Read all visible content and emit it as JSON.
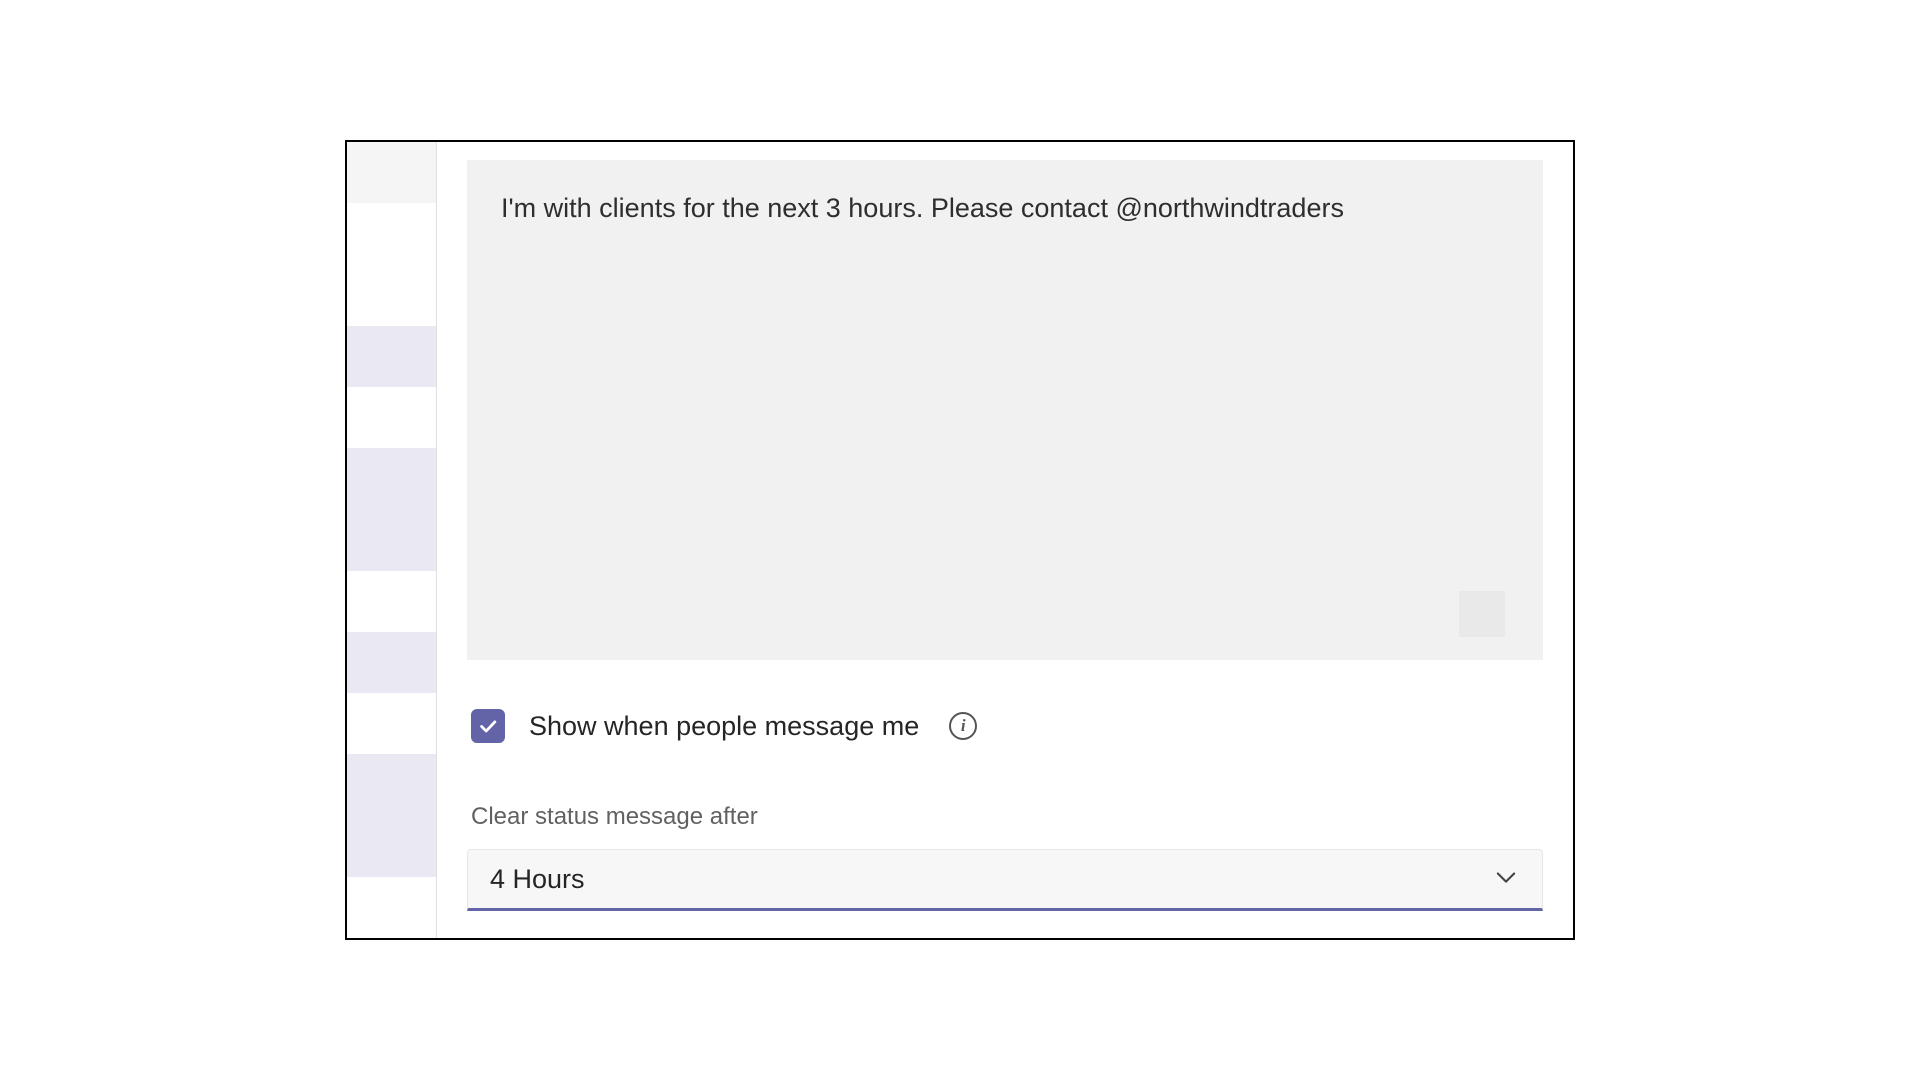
{
  "status": {
    "message_text": "I'm with clients for the next 3 hours. Please contact @northwindtraders"
  },
  "checkbox": {
    "label": "Show when people message me",
    "checked": true,
    "info_icon": "i"
  },
  "clear_after": {
    "section_label": "Clear status message after",
    "selected_value": "4 Hours"
  },
  "colors": {
    "accent": "#6264a7"
  }
}
